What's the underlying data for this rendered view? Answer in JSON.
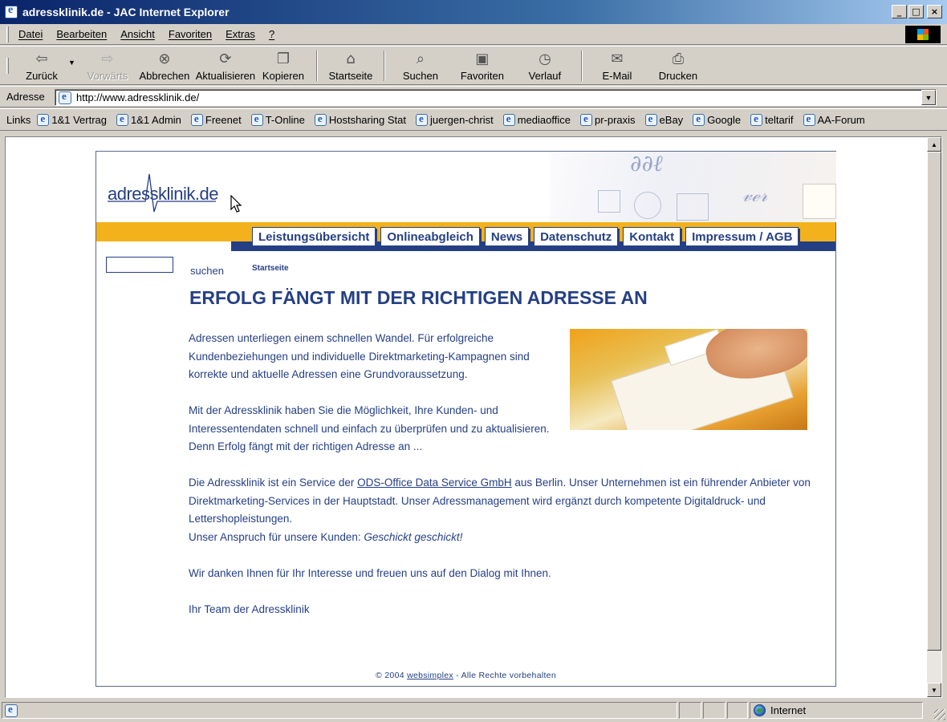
{
  "window": {
    "title": "adressklinik.de - JAC Internet Explorer",
    "buttons": [
      "_",
      "□",
      "×"
    ]
  },
  "menu": [
    "Datei",
    "Bearbeiten",
    "Ansicht",
    "Favoriten",
    "Extras",
    "?"
  ],
  "toolbar": {
    "back": "Zurück",
    "forward": "Vorwärts",
    "stop": "Abbrechen",
    "refresh": "Aktualisieren",
    "copy": "Kopieren",
    "home": "Startseite",
    "search": "Suchen",
    "favorites": "Favoriten",
    "history": "Verlauf",
    "mail": "E-Mail",
    "print": "Drucken"
  },
  "address": {
    "label": "Adresse",
    "url": "http://www.adressklinik.de/"
  },
  "links": {
    "label": "Links",
    "items": [
      "1&1 Vertrag",
      "1&1 Admin",
      "Freenet",
      "T-Online",
      "Hostsharing Stat",
      "juergen-christ",
      "mediaoffice",
      "pr-praxis",
      "eBay",
      "Google",
      "teltarif",
      "AA-Forum"
    ]
  },
  "site": {
    "logo": "adressklinik.de",
    "nav": [
      "Leistungsübersicht",
      "Onlineabgleich",
      "News",
      "Datenschutz",
      "Kontakt",
      "Impressum / AGB"
    ],
    "search_label": "suchen",
    "search_value": "",
    "breadcrumb": "Startseite",
    "headline": "ERFOLG FÄNGT MIT DER RICHTIGEN ADRESSE AN",
    "p1": "Adressen unterliegen einem schnellen Wandel. Für erfolgreiche Kundenbeziehungen und individuelle Direktmarketing-Kampagnen sind korrekte und aktuelle Adressen eine Grundvoraussetzung.",
    "p2": "Mit der Adressklinik haben Sie die Möglichkeit, Ihre Kunden- und Interessentendaten schnell und einfach zu überprüfen und zu aktualisieren. Denn Erfolg fängt mit der richtigen Adresse an ...",
    "p3_pre": "Die Adressklinik ist ein Service der ",
    "p3_link": "ODS-Office Data Service GmbH",
    "p3_post": " aus Berlin. Unser Unternehmen ist ein führender Anbieter von Direktmarketing-Services in der Hauptstadt. Unser Adressmanagement wird ergänzt durch kompetente Digitaldruck- und Lettershopleistungen.",
    "p3_claim_pre": "Unser Anspruch für unsere Kunden: ",
    "p3_claim": "Geschickt geschickt!",
    "p4": "Wir danken Ihnen für Ihr Interesse und freuen uns auf den Dialog mit Ihnen.",
    "p5": "Ihr Team der Adressklinik",
    "footer_pre": "© 2004 ",
    "footer_link": "websimplex",
    "footer_post": " - Alle Rechte vorbehalten"
  },
  "status": {
    "zone": "Internet"
  },
  "colors": {
    "brand_blue": "#243f84",
    "brand_yellow": "#f3b21b"
  }
}
